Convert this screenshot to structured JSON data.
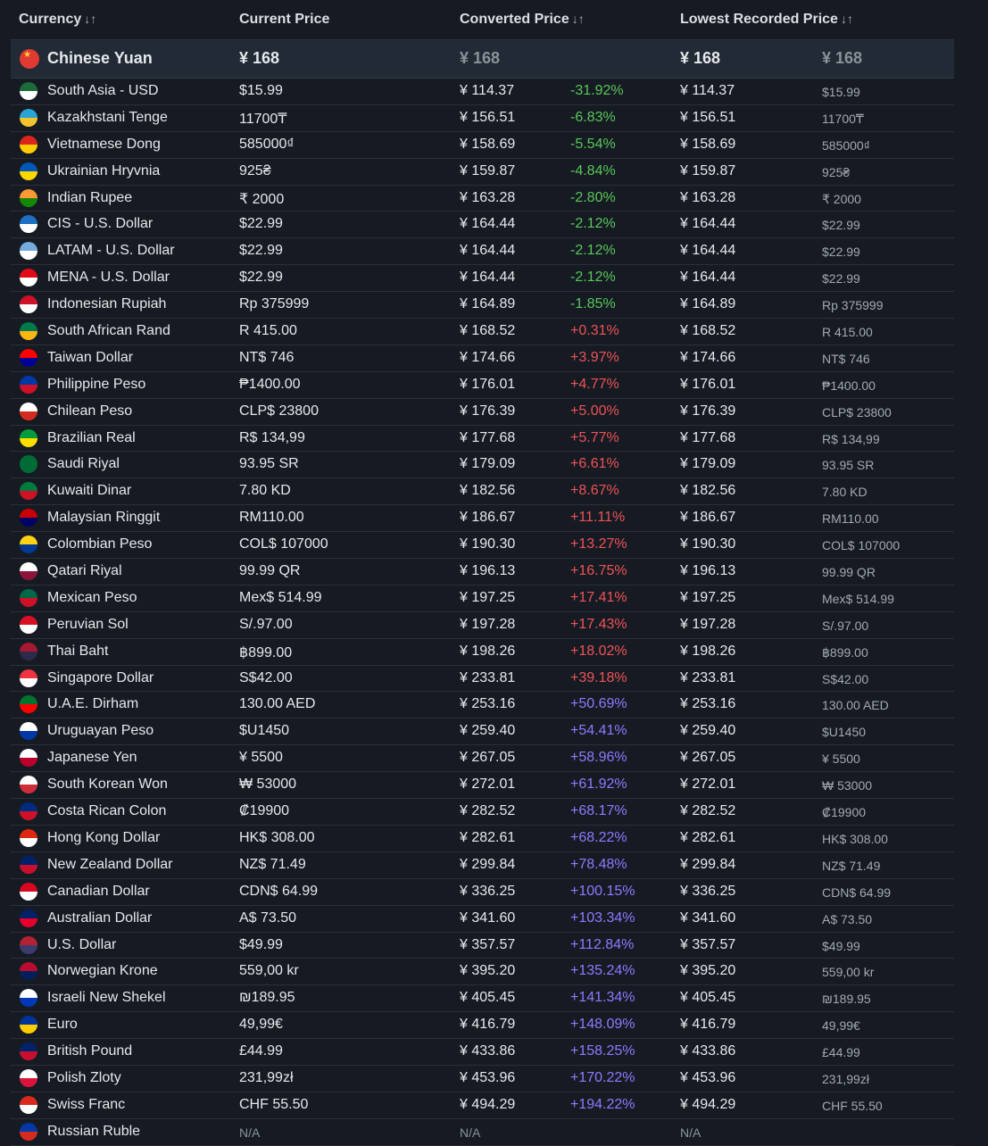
{
  "header": {
    "currency": "Currency",
    "current_price": "Current Price",
    "converted_price": "Converted Price",
    "lowest_price": "Lowest Recorded Price",
    "sort_glyph": "↓↑"
  },
  "base": {
    "name": "Chinese Yuan",
    "current": "¥ 168",
    "converted": "¥ 168",
    "lowest": "¥ 168",
    "lowest_local": "¥ 168"
  },
  "rows": [
    {
      "name": "South Asia - USD",
      "current": "$15.99",
      "converted": "¥ 114.37",
      "pct": "-31.92%",
      "lowest": "¥ 114.37",
      "lowest_local": "$15.99",
      "flag": [
        "#1e6b3a",
        "#fff"
      ]
    },
    {
      "name": "Kazakhstani Tenge",
      "current": "11700₸",
      "converted": "¥ 156.51",
      "pct": "-6.83%",
      "lowest": "¥ 156.51",
      "lowest_local": "11700₸",
      "flag": [
        "#2aa4d5",
        "#f4c430"
      ]
    },
    {
      "name": "Vietnamese Dong",
      "current": "585000₫",
      "converted": "¥ 158.69",
      "pct": "-5.54%",
      "lowest": "¥ 158.69",
      "lowest_local": "585000₫",
      "flag": [
        "#da251d",
        "#ffcd00"
      ]
    },
    {
      "name": "Ukrainian Hryvnia",
      "current": "925₴",
      "converted": "¥ 159.87",
      "pct": "-4.84%",
      "lowest": "¥ 159.87",
      "lowest_local": "925₴",
      "flag": [
        "#0057b7",
        "#ffd700"
      ]
    },
    {
      "name": "Indian Rupee",
      "current": "₹ 2000",
      "converted": "¥ 163.28",
      "pct": "-2.80%",
      "lowest": "¥ 163.28",
      "lowest_local": "₹ 2000",
      "flag": [
        "#ff9933",
        "#138808"
      ]
    },
    {
      "name": "CIS - U.S. Dollar",
      "current": "$22.99",
      "converted": "¥ 164.44",
      "pct": "-2.12%",
      "lowest": "¥ 164.44",
      "lowest_local": "$22.99",
      "flag": [
        "#1c6fc2",
        "#fff"
      ]
    },
    {
      "name": "LATAM - U.S. Dollar",
      "current": "$22.99",
      "converted": "¥ 164.44",
      "pct": "-2.12%",
      "lowest": "¥ 164.44",
      "lowest_local": "$22.99",
      "flag": [
        "#74acdf",
        "#fff"
      ]
    },
    {
      "name": "MENA - U.S. Dollar",
      "current": "$22.99",
      "converted": "¥ 164.44",
      "pct": "-2.12%",
      "lowest": "¥ 164.44",
      "lowest_local": "$22.99",
      "flag": [
        "#e30a17",
        "#fff"
      ]
    },
    {
      "name": "Indonesian Rupiah",
      "current": "Rp 375999",
      "converted": "¥ 164.89",
      "pct": "-1.85%",
      "lowest": "¥ 164.89",
      "lowest_local": "Rp 375999",
      "flag": [
        "#ce1126",
        "#fff"
      ]
    },
    {
      "name": "South African Rand",
      "current": "R 415.00",
      "converted": "¥ 168.52",
      "pct": "+0.31%",
      "lowest": "¥ 168.52",
      "lowest_local": "R 415.00",
      "flag": [
        "#007a4d",
        "#ffb612"
      ]
    },
    {
      "name": "Taiwan Dollar",
      "current": "NT$ 746",
      "converted": "¥ 174.66",
      "pct": "+3.97%",
      "lowest": "¥ 174.66",
      "lowest_local": "NT$ 746",
      "flag": [
        "#fe0000",
        "#000095"
      ]
    },
    {
      "name": "Philippine Peso",
      "current": "₱1400.00",
      "converted": "¥ 176.01",
      "pct": "+4.77%",
      "lowest": "¥ 176.01",
      "lowest_local": "₱1400.00",
      "flag": [
        "#0038a8",
        "#ce1126"
      ]
    },
    {
      "name": "Chilean Peso",
      "current": "CLP$ 23800",
      "converted": "¥ 176.39",
      "pct": "+5.00%",
      "lowest": "¥ 176.39",
      "lowest_local": "CLP$ 23800",
      "flag": [
        "#fff",
        "#d52b1e"
      ]
    },
    {
      "name": "Brazilian Real",
      "current": "R$ 134,99",
      "converted": "¥ 177.68",
      "pct": "+5.77%",
      "lowest": "¥ 177.68",
      "lowest_local": "R$ 134,99",
      "flag": [
        "#009c3b",
        "#ffdf00"
      ]
    },
    {
      "name": "Saudi Riyal",
      "current": "93.95 SR",
      "converted": "¥ 179.09",
      "pct": "+6.61%",
      "lowest": "¥ 179.09",
      "lowest_local": "93.95 SR",
      "flag": [
        "#006c35",
        "#006c35"
      ]
    },
    {
      "name": "Kuwaiti Dinar",
      "current": "7.80 KD",
      "converted": "¥ 182.56",
      "pct": "+8.67%",
      "lowest": "¥ 182.56",
      "lowest_local": "7.80 KD",
      "flag": [
        "#007a3d",
        "#ce1126"
      ]
    },
    {
      "name": "Malaysian Ringgit",
      "current": "RM110.00",
      "converted": "¥ 186.67",
      "pct": "+11.11%",
      "lowest": "¥ 186.67",
      "lowest_local": "RM110.00",
      "flag": [
        "#cc0001",
        "#010066"
      ]
    },
    {
      "name": "Colombian Peso",
      "current": "COL$ 107000",
      "converted": "¥ 190.30",
      "pct": "+13.27%",
      "lowest": "¥ 190.30",
      "lowest_local": "COL$ 107000",
      "flag": [
        "#fcd116",
        "#003893"
      ]
    },
    {
      "name": "Qatari Riyal",
      "current": "99.99 QR",
      "converted": "¥ 196.13",
      "pct": "+16.75%",
      "lowest": "¥ 196.13",
      "lowest_local": "99.99 QR",
      "flag": [
        "#fff",
        "#8a1538"
      ]
    },
    {
      "name": "Mexican Peso",
      "current": "Mex$ 514.99",
      "converted": "¥ 197.25",
      "pct": "+17.41%",
      "lowest": "¥ 197.25",
      "lowest_local": "Mex$ 514.99",
      "flag": [
        "#006847",
        "#ce1126"
      ]
    },
    {
      "name": "Peruvian Sol",
      "current": "S/.97.00",
      "converted": "¥ 197.28",
      "pct": "+17.43%",
      "lowest": "¥ 197.28",
      "lowest_local": "S/.97.00",
      "flag": [
        "#d91023",
        "#fff"
      ]
    },
    {
      "name": "Thai Baht",
      "current": "฿899.00",
      "converted": "¥ 198.26",
      "pct": "+18.02%",
      "lowest": "¥ 198.26",
      "lowest_local": "฿899.00",
      "flag": [
        "#a51931",
        "#2d2a4a"
      ]
    },
    {
      "name": "Singapore Dollar",
      "current": "S$42.00",
      "converted": "¥ 233.81",
      "pct": "+39.18%",
      "lowest": "¥ 233.81",
      "lowest_local": "S$42.00",
      "flag": [
        "#ef3340",
        "#fff"
      ]
    },
    {
      "name": "U.A.E. Dirham",
      "current": "130.00 AED",
      "converted": "¥ 253.16",
      "pct": "+50.69%",
      "lowest": "¥ 253.16",
      "lowest_local": "130.00 AED",
      "flag": [
        "#00732f",
        "#ff0000"
      ]
    },
    {
      "name": "Uruguayan Peso",
      "current": "$U1450",
      "converted": "¥ 259.40",
      "pct": "+54.41%",
      "lowest": "¥ 259.40",
      "lowest_local": "$U1450",
      "flag": [
        "#fff",
        "#0038a8"
      ]
    },
    {
      "name": "Japanese Yen",
      "current": "¥ 5500",
      "converted": "¥ 267.05",
      "pct": "+58.96%",
      "lowest": "¥ 267.05",
      "lowest_local": "¥ 5500",
      "flag": [
        "#fff",
        "#bc002d"
      ]
    },
    {
      "name": "South Korean Won",
      "current": "₩ 53000",
      "converted": "¥ 272.01",
      "pct": "+61.92%",
      "lowest": "¥ 272.01",
      "lowest_local": "₩ 53000",
      "flag": [
        "#fff",
        "#cd2e3a"
      ]
    },
    {
      "name": "Costa Rican Colon",
      "current": "₡19900",
      "converted": "¥ 282.52",
      "pct": "+68.17%",
      "lowest": "¥ 282.52",
      "lowest_local": "₡19900",
      "flag": [
        "#002b7f",
        "#ce1126"
      ]
    },
    {
      "name": "Hong Kong Dollar",
      "current": "HK$ 308.00",
      "converted": "¥ 282.61",
      "pct": "+68.22%",
      "lowest": "¥ 282.61",
      "lowest_local": "HK$ 308.00",
      "flag": [
        "#de2910",
        "#fff"
      ]
    },
    {
      "name": "New Zealand Dollar",
      "current": "NZ$ 71.49",
      "converted": "¥ 299.84",
      "pct": "+78.48%",
      "lowest": "¥ 299.84",
      "lowest_local": "NZ$ 71.49",
      "flag": [
        "#012169",
        "#c8102e"
      ]
    },
    {
      "name": "Canadian Dollar",
      "current": "CDN$ 64.99",
      "converted": "¥ 336.25",
      "pct": "+100.15%",
      "lowest": "¥ 336.25",
      "lowest_local": "CDN$ 64.99",
      "flag": [
        "#d80621",
        "#fff"
      ]
    },
    {
      "name": "Australian Dollar",
      "current": "A$ 73.50",
      "converted": "¥ 341.60",
      "pct": "+103.34%",
      "lowest": "¥ 341.60",
      "lowest_local": "A$ 73.50",
      "flag": [
        "#012169",
        "#e4002b"
      ]
    },
    {
      "name": "U.S. Dollar",
      "current": "$49.99",
      "converted": "¥ 357.57",
      "pct": "+112.84%",
      "lowest": "¥ 357.57",
      "lowest_local": "$49.99",
      "flag": [
        "#b22234",
        "#3c3b6e"
      ]
    },
    {
      "name": "Norwegian Krone",
      "current": "559,00 kr",
      "converted": "¥ 395.20",
      "pct": "+135.24%",
      "lowest": "¥ 395.20",
      "lowest_local": "559,00 kr",
      "flag": [
        "#ba0c2f",
        "#00205b"
      ]
    },
    {
      "name": "Israeli New Shekel",
      "current": "₪189.95",
      "converted": "¥ 405.45",
      "pct": "+141.34%",
      "lowest": "¥ 405.45",
      "lowest_local": "₪189.95",
      "flag": [
        "#fff",
        "#0038b8"
      ]
    },
    {
      "name": "Euro",
      "current": "49,99€",
      "converted": "¥ 416.79",
      "pct": "+148.09%",
      "lowest": "¥ 416.79",
      "lowest_local": "49,99€",
      "flag": [
        "#003399",
        "#ffcc00"
      ]
    },
    {
      "name": "British Pound",
      "current": "£44.99",
      "converted": "¥ 433.86",
      "pct": "+158.25%",
      "lowest": "¥ 433.86",
      "lowest_local": "£44.99",
      "flag": [
        "#012169",
        "#c8102e"
      ]
    },
    {
      "name": "Polish Zloty",
      "current": "231,99zł",
      "converted": "¥ 453.96",
      "pct": "+170.22%",
      "lowest": "¥ 453.96",
      "lowest_local": "231,99zł",
      "flag": [
        "#fff",
        "#dc143c"
      ]
    },
    {
      "name": "Swiss Franc",
      "current": "CHF 55.50",
      "converted": "¥ 494.29",
      "pct": "+194.22%",
      "lowest": "¥ 494.29",
      "lowest_local": "CHF 55.50",
      "flag": [
        "#da291c",
        "#fff"
      ]
    },
    {
      "name": "Russian Ruble",
      "current": "N/A",
      "converted": "N/A",
      "pct": "",
      "lowest": "N/A",
      "lowest_local": "",
      "flag": [
        "#0039a6",
        "#d52b1e"
      ]
    }
  ],
  "colors": {
    "negative": "#59c659",
    "positive_red": "#ee5257",
    "positive_purple": "#8b7bff"
  }
}
